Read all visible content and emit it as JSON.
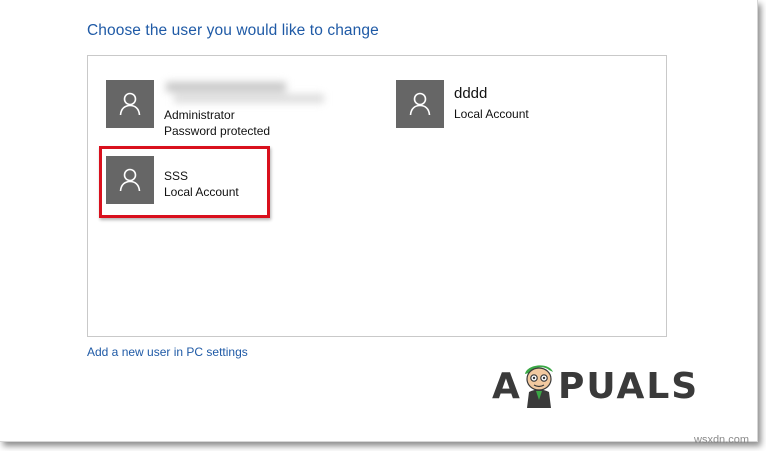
{
  "heading": "Choose the user you would like to change",
  "users": [
    {
      "name": "",
      "type": "Administrator",
      "status": "Password protected",
      "name_obscured": true
    },
    {
      "name": "dddd",
      "type": "Local Account"
    },
    {
      "name": "SSS",
      "type": "Local Account",
      "highlighted": true
    }
  ],
  "add_user_link": "Add a new user in PC settings",
  "logo": {
    "text_left": "A",
    "text_right": "PUALS"
  },
  "watermark": "wsxdn.com",
  "icons": {
    "user_avatar": "person-icon"
  },
  "colors": {
    "heading": "#1f5aa6",
    "tile": "#666666",
    "highlight_border": "#d9101d",
    "link": "#1f5aa6"
  }
}
